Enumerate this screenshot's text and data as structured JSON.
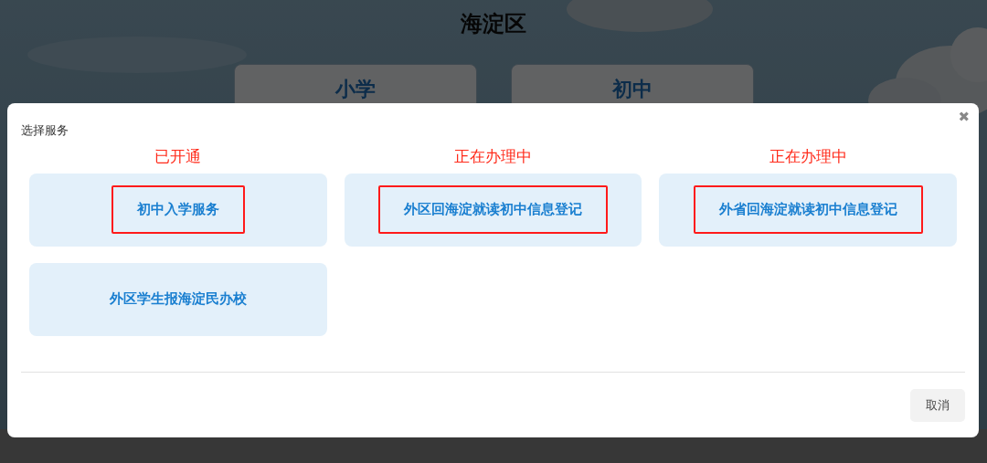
{
  "page": {
    "title": "海淀区",
    "options": [
      {
        "label": "小学"
      },
      {
        "label": "初中"
      }
    ]
  },
  "dialog": {
    "title": "选择服务",
    "close": "✖",
    "services": [
      {
        "label": "初中入学服务",
        "annotation": "已开通",
        "highlighted": true
      },
      {
        "label": "外区回海淀就读初中信息登记",
        "annotation": "正在办理中",
        "highlighted": true
      },
      {
        "label": "外省回海淀就读初中信息登记",
        "annotation": "正在办理中",
        "highlighted": true
      },
      {
        "label": "外区学生报海淀民办校",
        "highlighted": false
      }
    ],
    "buttons": [
      "取消"
    ]
  }
}
